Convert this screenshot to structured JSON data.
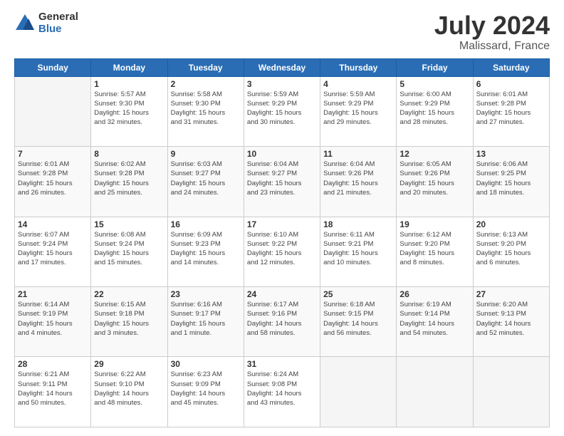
{
  "logo": {
    "general": "General",
    "blue": "Blue"
  },
  "header": {
    "month": "July 2024",
    "location": "Malissard, France"
  },
  "weekdays": [
    "Sunday",
    "Monday",
    "Tuesday",
    "Wednesday",
    "Thursday",
    "Friday",
    "Saturday"
  ],
  "weeks": [
    [
      {
        "day": "",
        "info": ""
      },
      {
        "day": "1",
        "info": "Sunrise: 5:57 AM\nSunset: 9:30 PM\nDaylight: 15 hours\nand 32 minutes."
      },
      {
        "day": "2",
        "info": "Sunrise: 5:58 AM\nSunset: 9:30 PM\nDaylight: 15 hours\nand 31 minutes."
      },
      {
        "day": "3",
        "info": "Sunrise: 5:59 AM\nSunset: 9:29 PM\nDaylight: 15 hours\nand 30 minutes."
      },
      {
        "day": "4",
        "info": "Sunrise: 5:59 AM\nSunset: 9:29 PM\nDaylight: 15 hours\nand 29 minutes."
      },
      {
        "day": "5",
        "info": "Sunrise: 6:00 AM\nSunset: 9:29 PM\nDaylight: 15 hours\nand 28 minutes."
      },
      {
        "day": "6",
        "info": "Sunrise: 6:01 AM\nSunset: 9:28 PM\nDaylight: 15 hours\nand 27 minutes."
      }
    ],
    [
      {
        "day": "7",
        "info": "Sunrise: 6:01 AM\nSunset: 9:28 PM\nDaylight: 15 hours\nand 26 minutes."
      },
      {
        "day": "8",
        "info": "Sunrise: 6:02 AM\nSunset: 9:28 PM\nDaylight: 15 hours\nand 25 minutes."
      },
      {
        "day": "9",
        "info": "Sunrise: 6:03 AM\nSunset: 9:27 PM\nDaylight: 15 hours\nand 24 minutes."
      },
      {
        "day": "10",
        "info": "Sunrise: 6:04 AM\nSunset: 9:27 PM\nDaylight: 15 hours\nand 23 minutes."
      },
      {
        "day": "11",
        "info": "Sunrise: 6:04 AM\nSunset: 9:26 PM\nDaylight: 15 hours\nand 21 minutes."
      },
      {
        "day": "12",
        "info": "Sunrise: 6:05 AM\nSunset: 9:26 PM\nDaylight: 15 hours\nand 20 minutes."
      },
      {
        "day": "13",
        "info": "Sunrise: 6:06 AM\nSunset: 9:25 PM\nDaylight: 15 hours\nand 18 minutes."
      }
    ],
    [
      {
        "day": "14",
        "info": "Sunrise: 6:07 AM\nSunset: 9:24 PM\nDaylight: 15 hours\nand 17 minutes."
      },
      {
        "day": "15",
        "info": "Sunrise: 6:08 AM\nSunset: 9:24 PM\nDaylight: 15 hours\nand 15 minutes."
      },
      {
        "day": "16",
        "info": "Sunrise: 6:09 AM\nSunset: 9:23 PM\nDaylight: 15 hours\nand 14 minutes."
      },
      {
        "day": "17",
        "info": "Sunrise: 6:10 AM\nSunset: 9:22 PM\nDaylight: 15 hours\nand 12 minutes."
      },
      {
        "day": "18",
        "info": "Sunrise: 6:11 AM\nSunset: 9:21 PM\nDaylight: 15 hours\nand 10 minutes."
      },
      {
        "day": "19",
        "info": "Sunrise: 6:12 AM\nSunset: 9:20 PM\nDaylight: 15 hours\nand 8 minutes."
      },
      {
        "day": "20",
        "info": "Sunrise: 6:13 AM\nSunset: 9:20 PM\nDaylight: 15 hours\nand 6 minutes."
      }
    ],
    [
      {
        "day": "21",
        "info": "Sunrise: 6:14 AM\nSunset: 9:19 PM\nDaylight: 15 hours\nand 4 minutes."
      },
      {
        "day": "22",
        "info": "Sunrise: 6:15 AM\nSunset: 9:18 PM\nDaylight: 15 hours\nand 3 minutes."
      },
      {
        "day": "23",
        "info": "Sunrise: 6:16 AM\nSunset: 9:17 PM\nDaylight: 15 hours\nand 1 minute."
      },
      {
        "day": "24",
        "info": "Sunrise: 6:17 AM\nSunset: 9:16 PM\nDaylight: 14 hours\nand 58 minutes."
      },
      {
        "day": "25",
        "info": "Sunrise: 6:18 AM\nSunset: 9:15 PM\nDaylight: 14 hours\nand 56 minutes."
      },
      {
        "day": "26",
        "info": "Sunrise: 6:19 AM\nSunset: 9:14 PM\nDaylight: 14 hours\nand 54 minutes."
      },
      {
        "day": "27",
        "info": "Sunrise: 6:20 AM\nSunset: 9:13 PM\nDaylight: 14 hours\nand 52 minutes."
      }
    ],
    [
      {
        "day": "28",
        "info": "Sunrise: 6:21 AM\nSunset: 9:11 PM\nDaylight: 14 hours\nand 50 minutes."
      },
      {
        "day": "29",
        "info": "Sunrise: 6:22 AM\nSunset: 9:10 PM\nDaylight: 14 hours\nand 48 minutes."
      },
      {
        "day": "30",
        "info": "Sunrise: 6:23 AM\nSunset: 9:09 PM\nDaylight: 14 hours\nand 45 minutes."
      },
      {
        "day": "31",
        "info": "Sunrise: 6:24 AM\nSunset: 9:08 PM\nDaylight: 14 hours\nand 43 minutes."
      },
      {
        "day": "",
        "info": ""
      },
      {
        "day": "",
        "info": ""
      },
      {
        "day": "",
        "info": ""
      }
    ]
  ]
}
